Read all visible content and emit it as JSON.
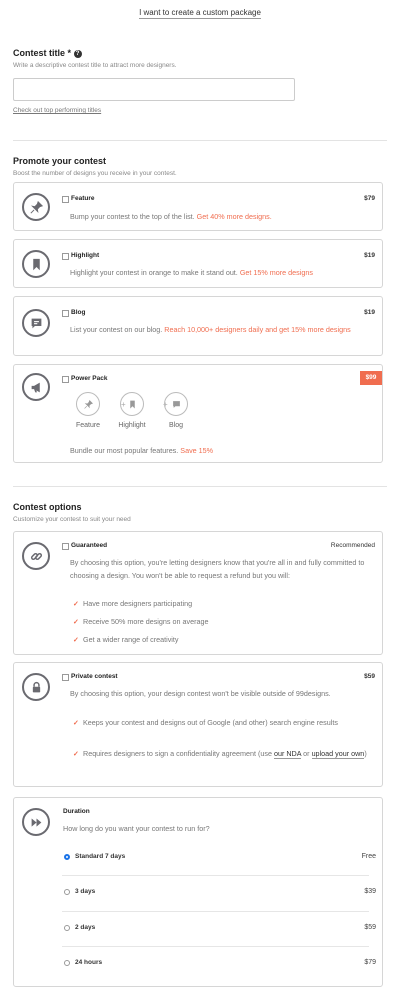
{
  "top_link": "I want to create a custom package",
  "contest_title": {
    "label": "Contest title *",
    "help_icon": "question-circle-icon",
    "helper": "Write a descriptive contest title to attract more designers.",
    "value": "",
    "link": "Check out top performing titles"
  },
  "promote": {
    "heading": "Promote your contest",
    "subheading": "Boost the number of designs you receive in your contest.",
    "items": [
      {
        "title": "Feature",
        "price": "$79",
        "desc": "Bump your contest to the top of the list.",
        "highlight": "Get 40% more designs.",
        "icon": "pin-icon"
      },
      {
        "title": "Highlight",
        "price": "$19",
        "desc": "Highlight your contest in orange to make it stand out.",
        "highlight": "Get 15% more designs",
        "icon": "bookmark-icon"
      },
      {
        "title": "Blog",
        "price": "$19",
        "desc": "List your contest on our blog.",
        "highlight": "Reach 10,000+ designers daily and get 15% more designs",
        "icon": "chat-icon"
      }
    ],
    "power_pack": {
      "title": "Power Pack",
      "price": "$99",
      "icon": "megaphone-icon",
      "components": [
        "Feature",
        "Highlight",
        "Blog"
      ],
      "plus": "+",
      "desc": "Bundle our most popular features.",
      "highlight": "Save 15%"
    }
  },
  "options": {
    "heading": "Contest options",
    "subheading": "Customize your contest to suit your need",
    "guaranteed": {
      "title": "Guaranteed",
      "tag": "Recommended",
      "icon": "link-icon",
      "desc": "By choosing this option, you're letting designers know that you're all in and fully committed to choosing a design. You won't be able to request a refund but you will:",
      "checks": [
        "Have more designers participating",
        "Receive 50% more designs on average",
        "Get a wider range of creativity"
      ]
    },
    "private": {
      "title": "Private contest",
      "price": "$59",
      "icon": "lock-icon",
      "desc": "By choosing this option, your design contest won't be visible outside of 99designs.",
      "check1": "Keeps your contest and designs out of Google (and other) search engine results",
      "check2_pre": "Requires designers to sign a confidentiality agreement (use",
      "nda_link": "our NDA",
      "check2_mid": "or",
      "upload_link": "upload your own",
      "check2_post": ")"
    },
    "duration": {
      "title": "Duration",
      "icon": "fast-forward-icon",
      "question": "How long do you want your contest to run for?",
      "rows": [
        {
          "label": "Standard 7 days",
          "price": "Free",
          "selected": true
        },
        {
          "label": "3 days",
          "price": "$39",
          "selected": false
        },
        {
          "label": "2 days",
          "price": "$59",
          "selected": false
        },
        {
          "label": "24 hours",
          "price": "$79",
          "selected": false
        }
      ]
    }
  },
  "colors": {
    "accent": "#f06d4f",
    "radio_selected": "#1a73e8"
  }
}
